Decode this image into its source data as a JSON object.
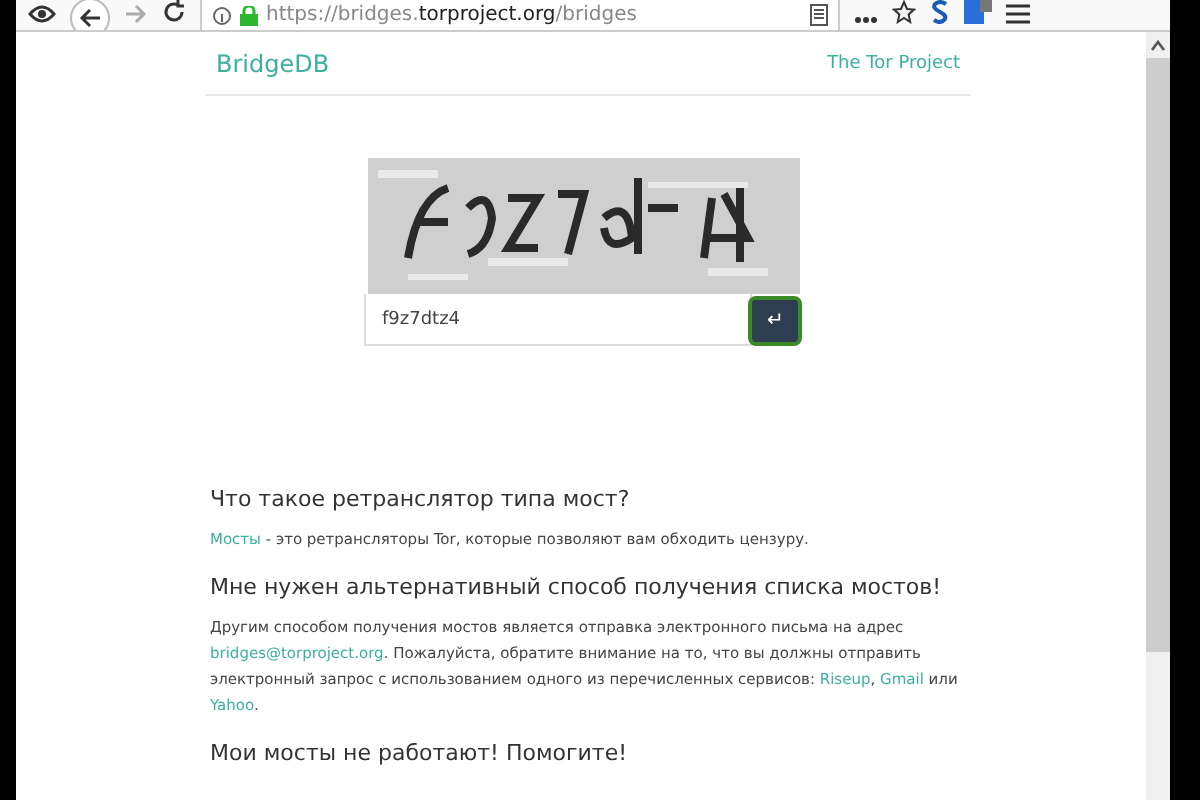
{
  "browser": {
    "url_parts": [
      {
        "text": "https://bridges.",
        "emphasis": false
      },
      {
        "text": "torproject.org",
        "emphasis": true
      },
      {
        "text": "/bridges",
        "emphasis": false
      }
    ]
  },
  "header": {
    "brand": "BridgeDB",
    "link": "The Tor Project"
  },
  "captcha": {
    "answer": "f9z7dtz4",
    "submit": "↵"
  },
  "sections": [
    {
      "heading": "Что такое ретранслятор типа мост?",
      "paragraph": [
        {
          "kind": "link",
          "text": "Мосты"
        },
        {
          "kind": "text",
          "text": " - это ретрансляторы Tor, которые позволяют вам обходить цензуру."
        }
      ]
    },
    {
      "heading": "Мне нужен альтернативный способ получения списка мостов!",
      "paragraph": [
        {
          "kind": "text",
          "text": "Другим способом получения мостов является отправка электронного письма на адрес "
        },
        {
          "kind": "link",
          "text": "bridges@torproject.org"
        },
        {
          "kind": "text",
          "text": ". Пожалуйста, обратите внимание на то, что вы должны отправить электронный запрос с использованием одного из перечисленных сервисов: "
        },
        {
          "kind": "link",
          "text": "Riseup"
        },
        {
          "kind": "text",
          "text": ", "
        },
        {
          "kind": "link",
          "text": "Gmail"
        },
        {
          "kind": "text",
          "text": " или "
        },
        {
          "kind": "link",
          "text": "Yahoo"
        },
        {
          "kind": "text",
          "text": "."
        }
      ]
    },
    {
      "heading": "Мои мосты не работают! Помогите!"
    }
  ]
}
